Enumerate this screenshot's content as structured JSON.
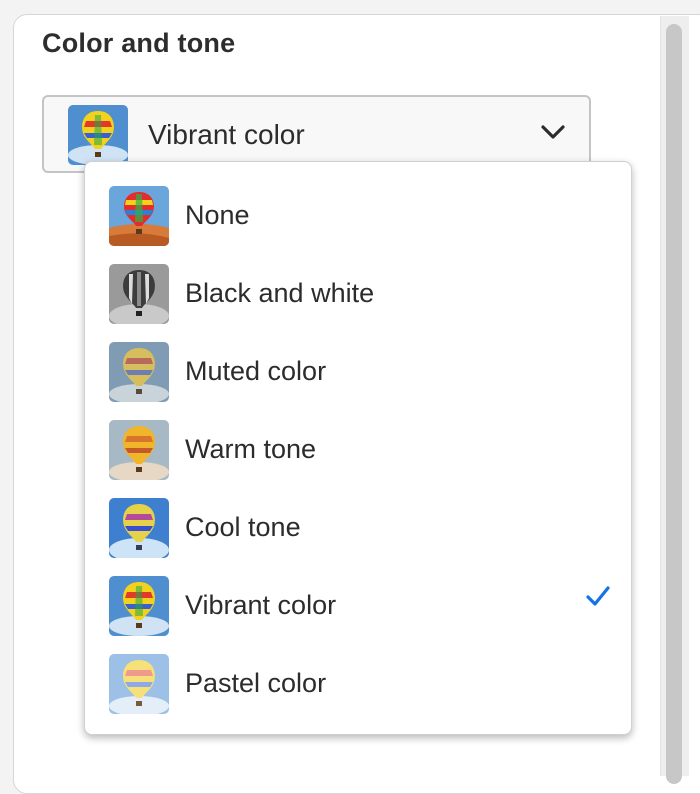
{
  "section": {
    "title": "Color and tone"
  },
  "picker": {
    "selected_label": "Vibrant color",
    "thumb_icon": "vibrant-balloon-thumbnail",
    "chevron_icon": "chevron-down-icon"
  },
  "menu": {
    "selected_index": 5,
    "check_icon": "checkmark-icon",
    "accent_color": "#1473e6",
    "items": [
      {
        "label": "None",
        "style": "none"
      },
      {
        "label": "Black and white",
        "style": "bw"
      },
      {
        "label": "Muted color",
        "style": "muted"
      },
      {
        "label": "Warm tone",
        "style": "warm"
      },
      {
        "label": "Cool tone",
        "style": "cool"
      },
      {
        "label": "Vibrant color",
        "style": "vibrant"
      },
      {
        "label": "Pastel color",
        "style": "pastel"
      }
    ]
  }
}
